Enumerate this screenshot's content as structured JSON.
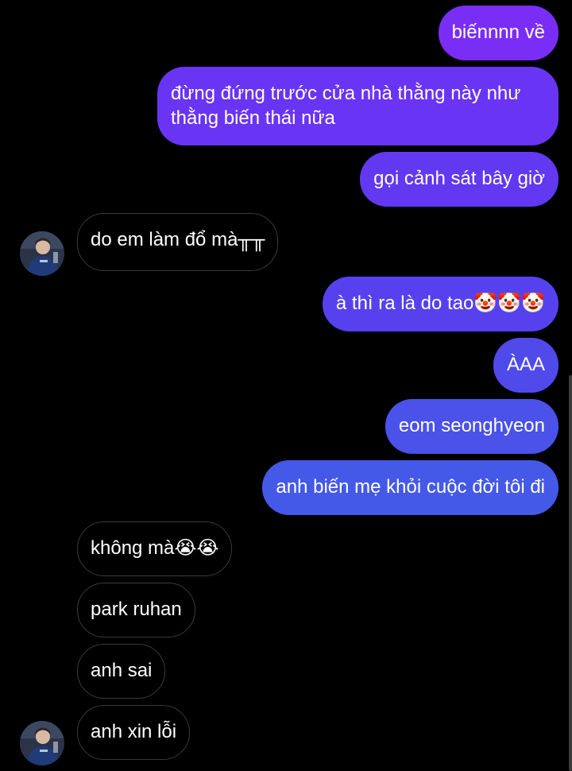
{
  "messages": [
    {
      "from": "me",
      "text": "biếnnnn về",
      "color": "#7a2ef5"
    },
    {
      "from": "me",
      "text": "đừng đứng trước cửa nhà thằng này như thằng biến thái nữa",
      "color": "#6a34f4"
    },
    {
      "from": "me",
      "text": "gọi cảnh sát bây giờ",
      "color": "#6238f1"
    },
    {
      "from": "them",
      "text": "do em làm đổ mà╥╥"
    },
    {
      "from": "me",
      "text": "à thì ra là do tao🤡🤡🤡",
      "color": "#5741ee"
    },
    {
      "from": "me",
      "text": "ÀAA",
      "color": "#504aeb"
    },
    {
      "from": "me",
      "text": "eom seonghyeon",
      "color": "#4a52ea"
    },
    {
      "from": "me",
      "text": "anh biến mẹ khỏi cuộc đời tôi đi",
      "color": "#4459e8"
    },
    {
      "from": "them",
      "text": "không mà😭😭"
    },
    {
      "from": "them",
      "text": "park ruhan"
    },
    {
      "from": "them",
      "text": "anh sai"
    },
    {
      "from": "them",
      "text": "anh xin lỗi"
    }
  ],
  "icons": {
    "avatar": "user-avatar-photo",
    "avatar_name": "contact-avatar"
  },
  "theme": {
    "background": "#000000",
    "incoming_border": "#3a3a3a"
  }
}
